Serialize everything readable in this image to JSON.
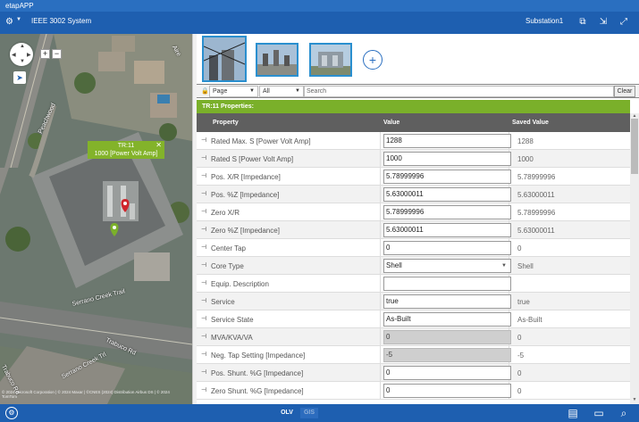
{
  "app": {
    "title": "etapAPP"
  },
  "header": {
    "system_title": "IEEE 3002 System",
    "substation": "Substation1",
    "icons": [
      "gear-icon",
      "chevron-down-icon",
      "network-icon",
      "export-icon",
      "expand-icon"
    ]
  },
  "map": {
    "popup_title": "TR:11",
    "popup_sub": "1000 [Power Volt Amp]",
    "popup_close": "✕",
    "zoom_in": "+",
    "zoom_out": "−",
    "roads": [
      "Trabuco Rd",
      "Serrano Creek Trail",
      "Trabuco Rd",
      "Serrano Creek Trl",
      "Peachwood",
      "Aire"
    ],
    "attribution": "© 2024 Microsoft Corporation | © 2024 Maxar | ©CNES (2024) Distribution Airbus DS | © 2024 TomTom"
  },
  "filter": {
    "scope": "Page",
    "category": "All",
    "search_placeholder": "Search",
    "clear_label": "Clear"
  },
  "properties": {
    "title": "TR:11 Properties:",
    "headers": {
      "property": "Property",
      "value": "Value",
      "saved": "Saved Value"
    },
    "rows": [
      {
        "property": "Rated Max. S [Power Volt Amp]",
        "value": "1288",
        "saved": "1288",
        "readonly": false
      },
      {
        "property": "Rated S [Power Volt Amp]",
        "value": "1000",
        "saved": "1000",
        "readonly": false
      },
      {
        "property": "Pos. X/R [Impedance]",
        "value": "5.78999996",
        "saved": "5.78999996",
        "readonly": false
      },
      {
        "property": "Pos. %Z [Impedance]",
        "value": "5.63000011",
        "saved": "5.63000011",
        "readonly": false
      },
      {
        "property": "Zero X/R",
        "value": "5.78999996",
        "saved": "5.78999996",
        "readonly": false
      },
      {
        "property": "Zero %Z [Impedance]",
        "value": "5.63000011",
        "saved": "5.63000011",
        "readonly": false
      },
      {
        "property": "Center Tap",
        "value": "0",
        "saved": "0",
        "readonly": false
      },
      {
        "property": "Core Type",
        "value": "Shell",
        "saved": "Shell",
        "readonly": false,
        "dropdown": true
      },
      {
        "property": "Equip. Description",
        "value": "",
        "saved": "",
        "readonly": false
      },
      {
        "property": "Service",
        "value": "true",
        "saved": "true",
        "readonly": false
      },
      {
        "property": "Service State",
        "value": "As-Built",
        "saved": "As-Built",
        "readonly": false
      },
      {
        "property": "MVA/KVA/VA",
        "value": "0",
        "saved": "0",
        "readonly": true
      },
      {
        "property": "Neg. Tap Setting [Impedance]",
        "value": "-5",
        "saved": "-5",
        "readonly": true
      },
      {
        "property": "Pos. Shunt. %G [Impedance]",
        "value": "0",
        "saved": "0",
        "readonly": false
      },
      {
        "property": "Zero Shunt. %G [Impedance]",
        "value": "0",
        "saved": "0",
        "readonly": false
      }
    ]
  },
  "footer": {
    "mode_olv": "OLV",
    "mode_gis": "GIS",
    "icons": [
      "settings-circle-icon",
      "edit-list-icon",
      "chat-icon",
      "search-icon"
    ]
  },
  "colors": {
    "header_blue": "#1e5fb0",
    "accent_green": "#7ab02a",
    "popup_green": "#83b32a",
    "column_header": "#5f5f5f"
  }
}
